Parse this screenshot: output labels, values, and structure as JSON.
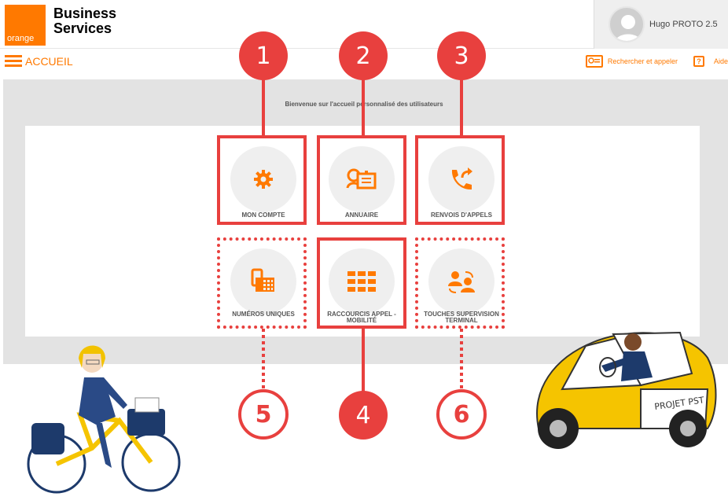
{
  "header": {
    "logo_text": "orange",
    "brand_line1": "Business",
    "brand_line2": "Services",
    "user_name": "Hugo PROTO 2.5"
  },
  "nav": {
    "page_title": "ACCUEIL",
    "search_call_label": "Rechercher et appeler",
    "help_icon_text": "?",
    "help_label": "Aide"
  },
  "welcome_text": "Bienvenue sur l'accueil personnalisé des utilisateurs",
  "tiles": [
    {
      "label": "MON COMPTE",
      "icon": "gear-icon"
    },
    {
      "label": "ANNUAIRE",
      "icon": "directory-icon"
    },
    {
      "label": "RENVOIS D'APPELS",
      "icon": "call-forward-icon"
    },
    {
      "label": "NUMÉROS UNIQUES",
      "icon": "phone-devices-icon"
    },
    {
      "label": "RACCOURCIS APPEL - MOBILITÉ",
      "icon": "keypad-grid-icon"
    },
    {
      "label": "TOUCHES SUPERVISION TERMINAL",
      "icon": "supervision-users-icon"
    }
  ],
  "badges": [
    "1",
    "2",
    "3",
    "4",
    "5",
    "6"
  ],
  "car_text": "PROJET PST",
  "colors": {
    "brand_orange": "#ff7900",
    "annotation_red": "#e8403e",
    "band_gray": "#e3e3e3"
  }
}
